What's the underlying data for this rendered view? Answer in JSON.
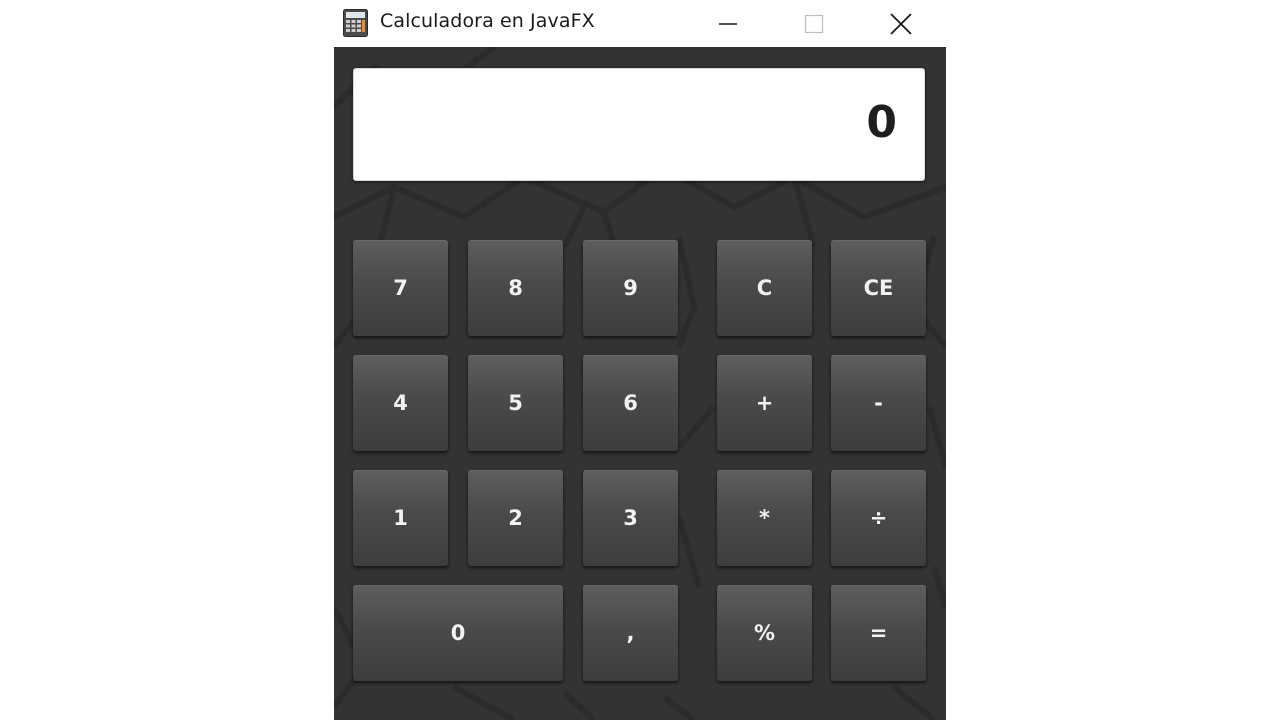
{
  "window": {
    "title": "Calculadora en JavaFX",
    "icon": "calculator-icon",
    "controls": [
      "minimize-icon",
      "maximize-icon",
      "close-icon"
    ]
  },
  "display": {
    "value": "0"
  },
  "keys": {
    "k7": "7",
    "k8": "8",
    "k9": "9",
    "kc": "C",
    "kce": "CE",
    "k4": "4",
    "k5": "5",
    "k6": "6",
    "kplus": "+",
    "kminus": "-",
    "k1": "1",
    "k2": "2",
    "k3": "3",
    "kmul": "*",
    "kdiv": "÷",
    "k0": "0",
    "kcomma": ",",
    "kpct": "%",
    "keq": "="
  },
  "colors": {
    "background": "#333333",
    "key": "#4a4a4a",
    "key_text": "#f2f2f2",
    "display_bg": "#ffffff",
    "display_text": "#1e1e1e"
  }
}
